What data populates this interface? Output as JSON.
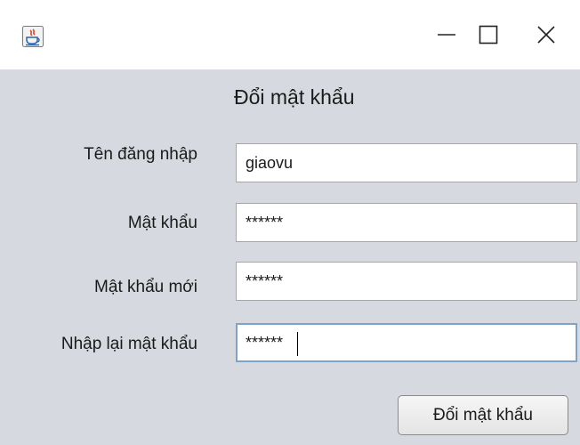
{
  "window": {
    "app_icon": "java-icon",
    "controls": {
      "minimize_icon": "minimize-icon",
      "maximize_icon": "maximize-icon",
      "close_icon": "close-icon"
    }
  },
  "form": {
    "title": "Đổi mật khẩu",
    "username_label": "Tên đăng nhập",
    "username_value": "giaovu",
    "password_label": "Mật khẩu",
    "password_value": "******",
    "new_password_label": "Mật khẩu mới",
    "new_password_value": "******",
    "confirm_password_label": "Nhập lại mật khẩu",
    "confirm_password_value": "******",
    "submit_label": "Đổi mật khẩu"
  },
  "colors": {
    "background": "#d6d9df",
    "focus_border": "#7ea3c6"
  }
}
